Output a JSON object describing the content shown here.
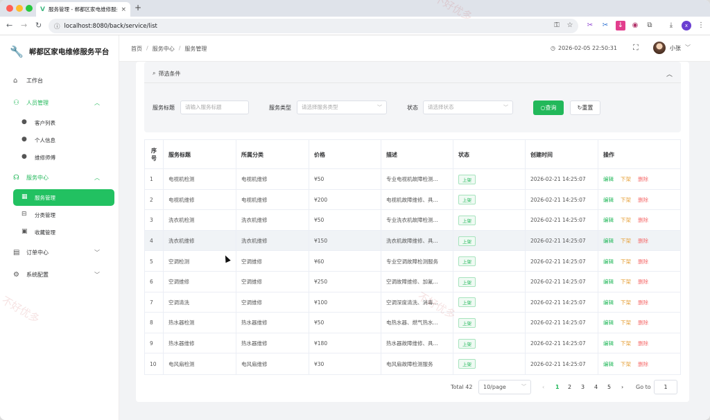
{
  "browser": {
    "tab_title": "服务管理 - 郸都区家电维修服务平台",
    "new_tab": "+",
    "url": "localhost:8080/back/service/list",
    "profile_initial": "x"
  },
  "sidebar": {
    "logo_text": "郸都区家电维修服务平台",
    "items": [
      {
        "label": "工作台",
        "icon": "home-icon"
      },
      {
        "label": "人员管理",
        "icon": "user-icon",
        "children": [
          {
            "label": "客户列表",
            "icon": "person-icon"
          },
          {
            "label": "个人信息",
            "icon": "person-icon"
          },
          {
            "label": "维修师傅",
            "icon": "person-icon"
          }
        ]
      },
      {
        "label": "服务中心",
        "icon": "headset-icon",
        "children": [
          {
            "label": "服务管理",
            "icon": "grid-icon"
          },
          {
            "label": "分类管理",
            "icon": "box-icon"
          },
          {
            "label": "收藏管理",
            "icon": "bookmark-icon"
          }
        ]
      },
      {
        "label": "订单中心",
        "icon": "document-icon"
      },
      {
        "label": "系统配置",
        "icon": "gear-icon"
      }
    ]
  },
  "header": {
    "breadcrumb": [
      "首页",
      "服务中心",
      "服务管理"
    ],
    "breadcrumb_sep": "/",
    "datetime": "2026-02-05 22:50:31",
    "username": "小张"
  },
  "filter": {
    "title": "筛选条件",
    "title_label": "服务标题",
    "title_placeholder": "请输入服务标题",
    "type_label": "服务类型",
    "type_placeholder": "请选择服务类型",
    "status_label": "状态",
    "status_placeholder": "请选择状态",
    "query_button": "查询",
    "reset_button": "重置"
  },
  "table": {
    "headers": [
      "序号",
      "服务标题",
      "所属分类",
      "价格",
      "描述",
      "状态",
      "创建时间",
      "操作"
    ],
    "actions": {
      "edit": "编辑",
      "offline": "下架",
      "delete": "删除"
    },
    "rows": [
      {
        "no": "1",
        "title": "电视机检测",
        "category": "电视机维修",
        "price": "¥50",
        "desc": "专业电视机故障检测...",
        "status": "上架",
        "created": "2026-02-21 14:25:07"
      },
      {
        "no": "2",
        "title": "电视机维修",
        "category": "电视机维修",
        "price": "¥200",
        "desc": "电视机故障维修、具...",
        "status": "上架",
        "created": "2026-02-21 14:25:07"
      },
      {
        "no": "3",
        "title": "洗衣机检测",
        "category": "洗衣机维修",
        "price": "¥50",
        "desc": "专业洗衣机故障检测...",
        "status": "上架",
        "created": "2026-02-21 14:25:07"
      },
      {
        "no": "4",
        "title": "洗衣机维修",
        "category": "洗衣机维修",
        "price": "¥150",
        "desc": "洗衣机故障维修、具...",
        "status": "上架",
        "created": "2026-02-21 14:25:07"
      },
      {
        "no": "5",
        "title": "空调检测",
        "category": "空调维修",
        "price": "¥60",
        "desc": "专业空调故障检测服务",
        "status": "上架",
        "created": "2026-02-21 14:25:07"
      },
      {
        "no": "6",
        "title": "空调维修",
        "category": "空调维修",
        "price": "¥250",
        "desc": "空调故障维修、加氟...",
        "status": "上架",
        "created": "2026-02-21 14:25:07"
      },
      {
        "no": "7",
        "title": "空调清洗",
        "category": "空调维修",
        "price": "¥100",
        "desc": "空调深度清洗、消毒...",
        "status": "上架",
        "created": "2026-02-21 14:25:07"
      },
      {
        "no": "8",
        "title": "热水器检测",
        "category": "热水器维修",
        "price": "¥50",
        "desc": "电热水器、燃气热水...",
        "status": "上架",
        "created": "2026-02-21 14:25:07"
      },
      {
        "no": "9",
        "title": "热水器维修",
        "category": "热水器维修",
        "price": "¥180",
        "desc": "热水器故障维修、具...",
        "status": "上架",
        "created": "2026-02-21 14:25:07"
      },
      {
        "no": "10",
        "title": "电风扇检测",
        "category": "电风扇维修",
        "price": "¥30",
        "desc": "电风扇故障检测服务",
        "status": "上架",
        "created": "2026-02-21 14:25:07"
      }
    ]
  },
  "pagination": {
    "total": "Total 42",
    "page_size": "10/page",
    "pages": [
      "1",
      "2",
      "3",
      "4",
      "5"
    ],
    "current": "1",
    "goto_label": "Go to",
    "goto_value": "1"
  },
  "watermark": "不好优多",
  "colors": {
    "accent": "#22b85a",
    "warning": "#e6a23c",
    "danger": "#f56c6c"
  }
}
